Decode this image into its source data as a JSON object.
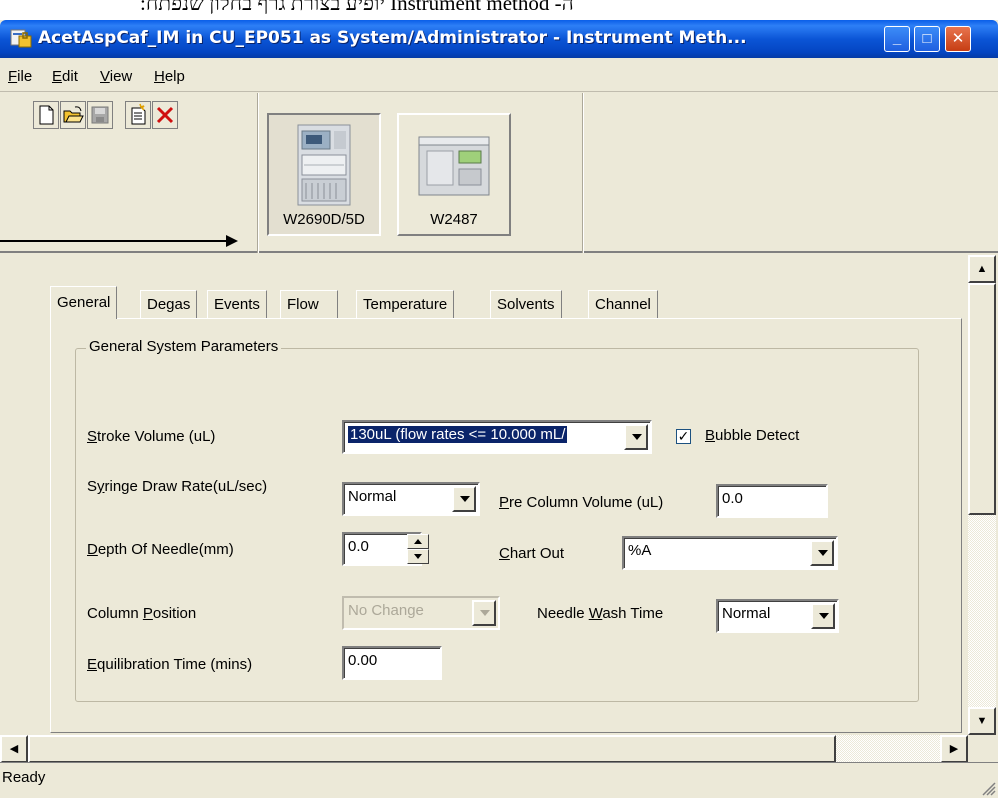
{
  "banner": {
    "text": "ה- Instrument method יופיע בצורת גרף בחלון שנפתח:"
  },
  "window": {
    "title": "AcetAspCaf_IM in CU_EP051 as System/Administrator - Instrument Meth...",
    "controls": {
      "minimize": "_",
      "maximize": "□",
      "close": "✕"
    }
  },
  "menu": [
    {
      "label": "File",
      "accel": "F",
      "rest": "ile"
    },
    {
      "label": "Edit",
      "accel": "E",
      "rest": "dit"
    },
    {
      "label": "View",
      "accel": "V",
      "rest": "iew"
    },
    {
      "label": "Help",
      "accel": "H",
      "rest": "elp"
    }
  ],
  "toolbar": {
    "icons": [
      "new-document-icon",
      "open-folder-icon",
      "save-disk-icon",
      "properties-document-icon",
      "delete-x-icon"
    ]
  },
  "instruments": [
    {
      "label": "W2690D/5D",
      "active": true
    },
    {
      "label": "W2487",
      "active": false
    }
  ],
  "tabs": {
    "items": [
      "General",
      "Degas",
      "Events",
      "Flow",
      "Temperature",
      "Solvents",
      "Channel"
    ],
    "active": "General"
  },
  "general": {
    "group_title": "General System Parameters",
    "stroke_volume": {
      "label_accel": "S",
      "label_rest": "troke Volume (uL)",
      "value": "130uL (flow rates <= 10.000 mL/"
    },
    "bubble_detect": {
      "label_accel": "B",
      "label_rest": "ubble Detect",
      "checked": true
    },
    "syringe_draw_rate": {
      "label_pre": "S",
      "label_accel": "y",
      "label_rest": "ringe Draw Rate(uL/sec)",
      "value": "Normal"
    },
    "pre_column_volume": {
      "label_accel": "P",
      "label_rest": "re Column Volume (uL)",
      "value": "0.0"
    },
    "depth_of_needle": {
      "label_accel": "D",
      "label_rest": "epth Of Needle(mm)",
      "value": "0.0"
    },
    "chart_out": {
      "label_accel": "C",
      "label_rest": "hart Out",
      "value": "%A"
    },
    "column_position": {
      "label_pre": "Column ",
      "label_accel": "P",
      "label_rest": "osition",
      "value": "No Change",
      "disabled": true
    },
    "needle_wash_time": {
      "label_pre": "Needle ",
      "label_accel": "W",
      "label_rest": "ash Time",
      "value": "Normal"
    },
    "equilibration_time": {
      "label_accel": "E",
      "label_rest": "quilibration Time (mins)",
      "value": "0.00"
    }
  },
  "status": {
    "text": "Ready"
  }
}
